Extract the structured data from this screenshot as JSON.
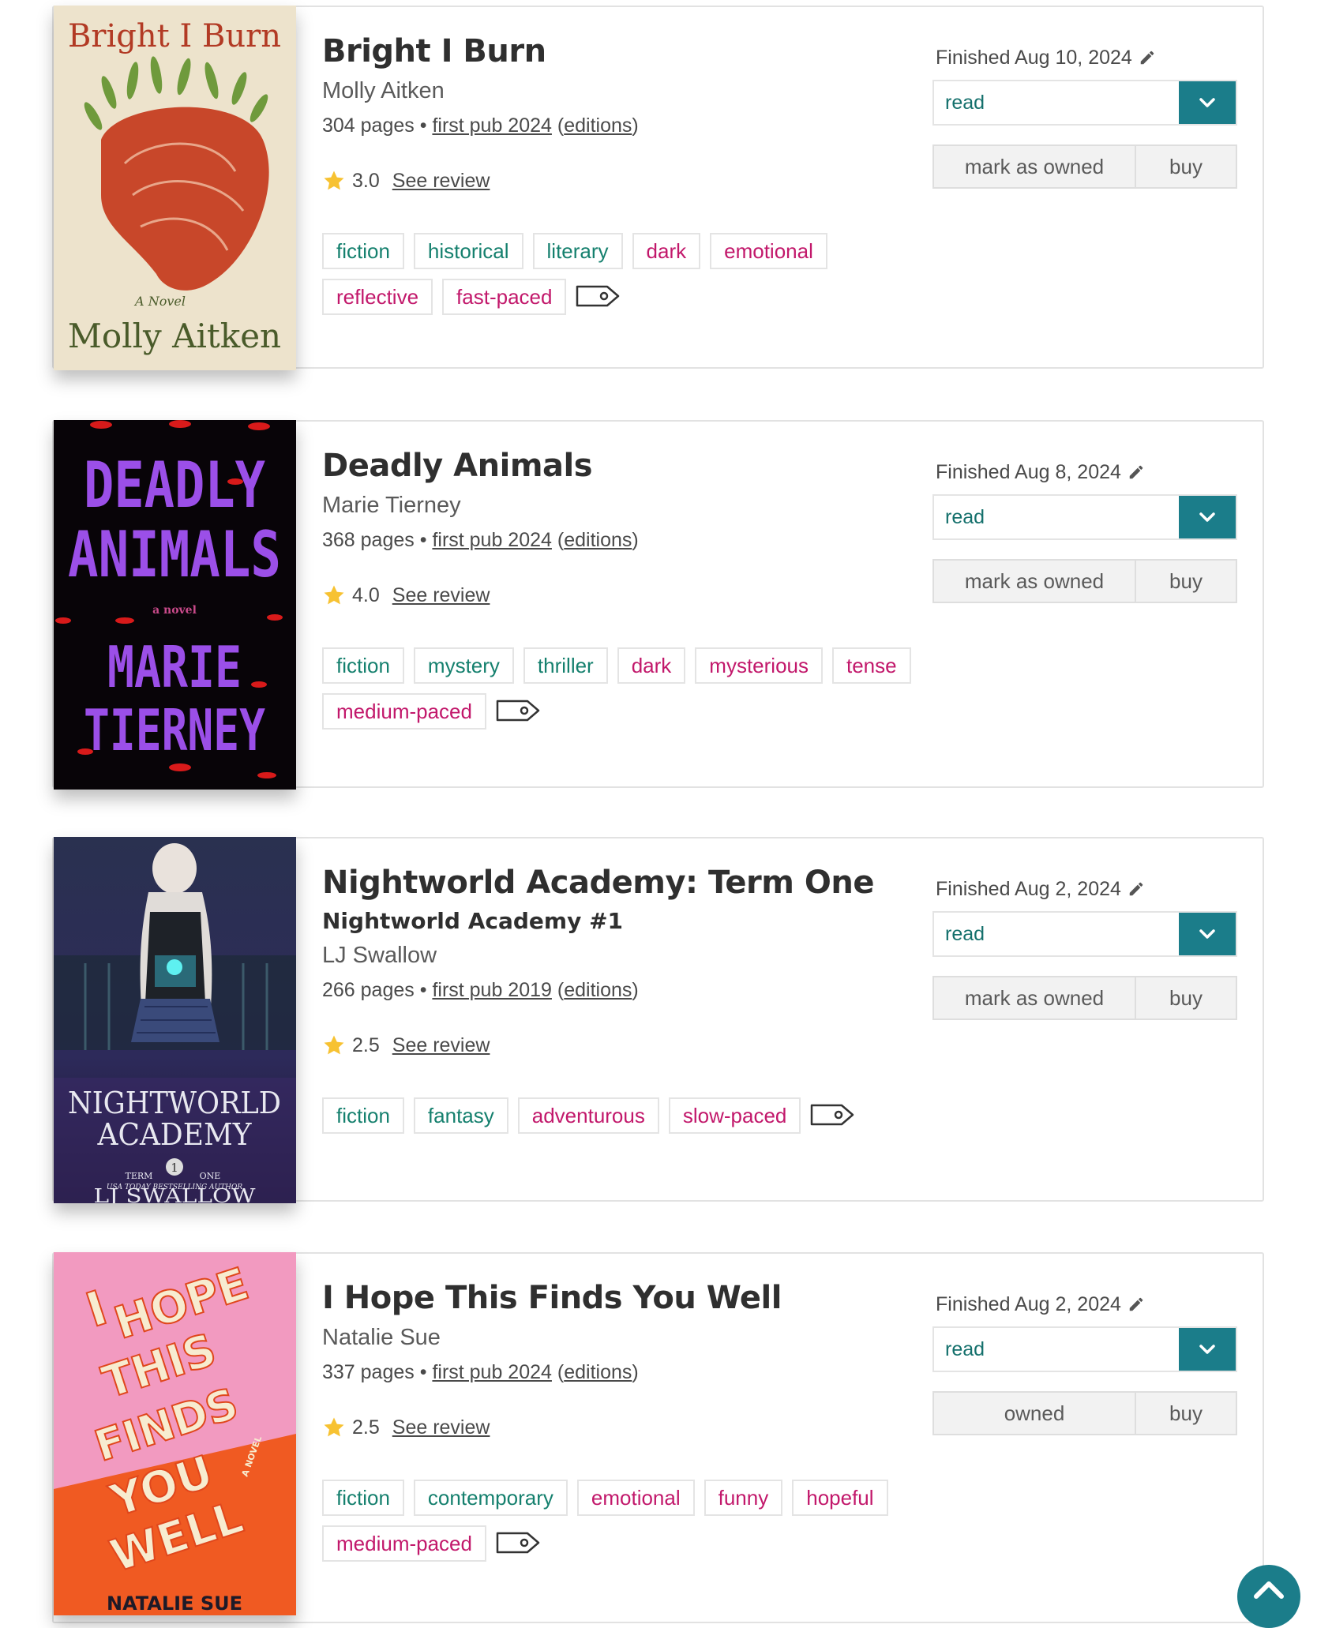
{
  "colors": {
    "teal": "#1b7d8a",
    "genre_tag": "#15806e",
    "mood_tag": "#c2186b",
    "star": "#f7c232"
  },
  "books": [
    {
      "title": "Bright I Burn",
      "series": "",
      "author": "Molly Aitken",
      "pages": "304 pages",
      "pub": "first pub 2024",
      "editions": "editions",
      "rating": "3.0",
      "review_link": "See review",
      "finished": "Finished Aug 10, 2024",
      "status": "read",
      "owned_label": "mark as owned",
      "buy_label": "buy",
      "tags": [
        {
          "label": "fiction",
          "kind": "genre"
        },
        {
          "label": "historical",
          "kind": "genre"
        },
        {
          "label": "literary",
          "kind": "genre"
        },
        {
          "label": "dark",
          "kind": "mood"
        },
        {
          "label": "emotional",
          "kind": "mood"
        },
        {
          "label": "reflective",
          "kind": "mood"
        },
        {
          "label": "fast-paced",
          "kind": "mood"
        }
      ],
      "cover_text": [
        "Bright I Burn",
        "A Novel",
        "Molly Aitken"
      ]
    },
    {
      "title": "Deadly Animals",
      "series": "",
      "author": "Marie Tierney",
      "pages": "368 pages",
      "pub": "first pub 2024",
      "editions": "editions",
      "rating": "4.0",
      "review_link": "See review",
      "finished": "Finished Aug 8, 2024",
      "status": "read",
      "owned_label": "mark as owned",
      "buy_label": "buy",
      "tags": [
        {
          "label": "fiction",
          "kind": "genre"
        },
        {
          "label": "mystery",
          "kind": "genre"
        },
        {
          "label": "thriller",
          "kind": "genre"
        },
        {
          "label": "dark",
          "kind": "mood"
        },
        {
          "label": "mysterious",
          "kind": "mood"
        },
        {
          "label": "tense",
          "kind": "mood"
        },
        {
          "label": "medium-paced",
          "kind": "mood"
        }
      ],
      "cover_text": [
        "DEADLY",
        "ANIMALS",
        "a novel",
        "MARIE",
        "TIERNEY"
      ]
    },
    {
      "title": "Nightworld Academy: Term One",
      "series": "Nightworld Academy #1",
      "author": "LJ Swallow",
      "pages": "266 pages",
      "pub": "first pub 2019",
      "editions": "editions",
      "rating": "2.5",
      "review_link": "See review",
      "finished": "Finished Aug 2, 2024",
      "status": "read",
      "owned_label": "mark as owned",
      "buy_label": "buy",
      "tags": [
        {
          "label": "fiction",
          "kind": "genre"
        },
        {
          "label": "fantasy",
          "kind": "genre"
        },
        {
          "label": "adventurous",
          "kind": "mood"
        },
        {
          "label": "slow-paced",
          "kind": "mood"
        }
      ],
      "cover_text": [
        "NIGHTWORLD",
        "ACADEMY",
        "TERM",
        "1",
        "ONE",
        "USA TODAY BESTSELLING AUTHOR",
        "LJ SWALLOW"
      ]
    },
    {
      "title": "I Hope This Finds You Well",
      "series": "",
      "author": "Natalie Sue",
      "pages": "337 pages",
      "pub": "first pub 2024",
      "editions": "editions",
      "rating": "2.5",
      "review_link": "See review",
      "finished": "Finished Aug 2, 2024",
      "status": "read",
      "owned_label": "owned",
      "buy_label": "buy",
      "tags": [
        {
          "label": "fiction",
          "kind": "genre"
        },
        {
          "label": "contemporary",
          "kind": "genre"
        },
        {
          "label": "emotional",
          "kind": "mood"
        },
        {
          "label": "funny",
          "kind": "mood"
        },
        {
          "label": "hopeful",
          "kind": "mood"
        },
        {
          "label": "medium-paced",
          "kind": "mood"
        }
      ],
      "cover_text": [
        "I",
        "HOPE",
        "THIS",
        "FINDS",
        "YOU",
        "WELL",
        "A NOVEL",
        "NATALIE SUE"
      ]
    }
  ],
  "icons": {
    "star": "star-icon",
    "pencil": "pencil-icon",
    "chevron": "chevron-down-icon",
    "tag": "tag-icon",
    "scroll_top": "chevron-up-icon"
  }
}
